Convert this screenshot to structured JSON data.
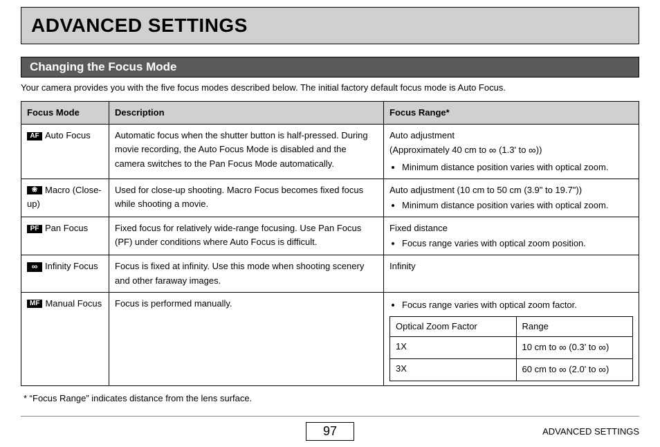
{
  "title": "ADVANCED SETTINGS",
  "section": "Changing the Focus Mode",
  "intro": "Your camera provides you with the five focus modes described below. The initial factory default focus mode is Auto Focus.",
  "headers": {
    "mode": "Focus Mode",
    "desc": "Description",
    "range": "Focus Range*"
  },
  "rows": {
    "auto": {
      "icon": "AF",
      "name": "Auto Focus",
      "desc": "Automatic focus when the shutter button is half-pressed. During movie recording, the Auto Focus Mode is disabled and the camera switches to the Pan Focus Mode automatically.",
      "range_line1": "Auto adjustment",
      "range_line2_a": "(Approximately 40 cm to ",
      "range_line2_b": " (1.3' to ",
      "range_line2_c": "))",
      "range_bullet": "Minimum distance position varies with optical zoom."
    },
    "macro": {
      "icon": "❀",
      "name": "Macro (Close-up)",
      "desc": "Used for close-up shooting. Macro Focus becomes fixed focus while shooting a movie.",
      "range_line1": "Auto adjustment (10 cm to 50 cm (3.9\" to 19.7\"))",
      "range_bullet": "Minimum distance position varies with optical zoom."
    },
    "pan": {
      "icon": "PF",
      "name": "Pan Focus",
      "desc": "Fixed focus for relatively wide-range focusing. Use Pan Focus (PF) under conditions where Auto Focus is difficult.",
      "range_line1": "Fixed distance",
      "range_bullet": "Focus range varies with optical zoom position."
    },
    "infinity": {
      "icon": "∞",
      "name": "Infinity Focus",
      "desc": "Focus is fixed at infinity. Use this mode when shooting scenery and other faraway images.",
      "range_line1": "Infinity"
    },
    "manual": {
      "icon": "MF",
      "name": "Manual Focus",
      "desc": "Focus is performed manually.",
      "range_bullet": "Focus range varies with optical zoom factor.",
      "inner": {
        "h1": "Optical Zoom Factor",
        "h2": "Range",
        "r1c1": "1X",
        "r1c2_a": "10 cm to ",
        "r1c2_b": " (0.3' to ",
        "r1c2_c": ")",
        "r2c1": "3X",
        "r2c2_a": "60 cm to ",
        "r2c2_b": " (2.0' to ",
        "r2c2_c": ")"
      }
    }
  },
  "footnote": "*  “Focus Range” indicates distance from the lens surface.",
  "footer": {
    "page": "97",
    "label": "ADVANCED SETTINGS"
  },
  "sym": {
    "inf": "∞"
  }
}
